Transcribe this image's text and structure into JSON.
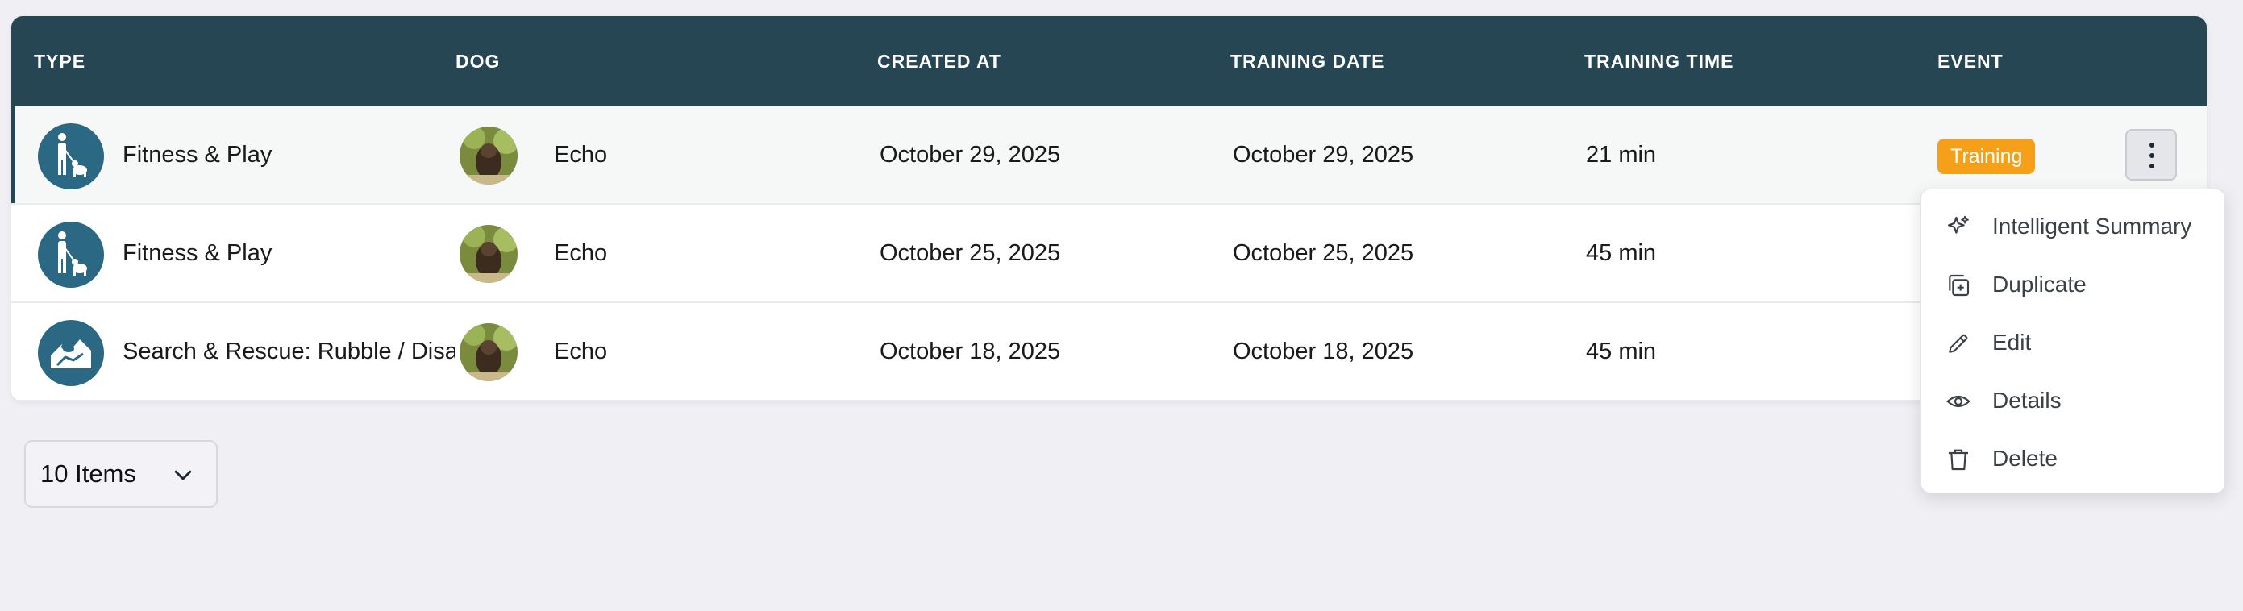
{
  "table": {
    "columns": [
      "TYPE",
      "DOG",
      "CREATED AT",
      "TRAINING DATE",
      "TRAINING TIME",
      "EVENT"
    ],
    "rows": [
      {
        "type": "Fitness & Play",
        "type_icon": "person-with-dog-icon",
        "dog": "Echo",
        "created_at": "October 29, 2025",
        "training_date": "October 29, 2025",
        "training_time": "21 min",
        "event": "Training"
      },
      {
        "type": "Fitness & Play",
        "type_icon": "person-with-dog-icon",
        "dog": "Echo",
        "created_at": "October 25, 2025",
        "training_date": "October 25, 2025",
        "training_time": "45 min",
        "event": ""
      },
      {
        "type": "Search & Rescue: Rubble / Disaster",
        "type_icon": "rubble-dog-icon",
        "dog": "Echo",
        "created_at": "October 18, 2025",
        "training_date": "October 18, 2025",
        "training_time": "45 min",
        "event": ""
      }
    ]
  },
  "context_menu": {
    "items": [
      {
        "label": "Intelligent Summary",
        "icon": "sparkles-icon"
      },
      {
        "label": "Duplicate",
        "icon": "duplicate-icon"
      },
      {
        "label": "Edit",
        "icon": "pencil-icon"
      },
      {
        "label": "Details",
        "icon": "eye-icon"
      },
      {
        "label": "Delete",
        "icon": "trash-icon"
      }
    ]
  },
  "pagination": {
    "page_size_label": "10 Items"
  },
  "colors": {
    "header_bg": "#264653",
    "type_icon_bg": "#2b6883",
    "event_badge": "#f6a01a",
    "page_bg": "#efeff4"
  }
}
